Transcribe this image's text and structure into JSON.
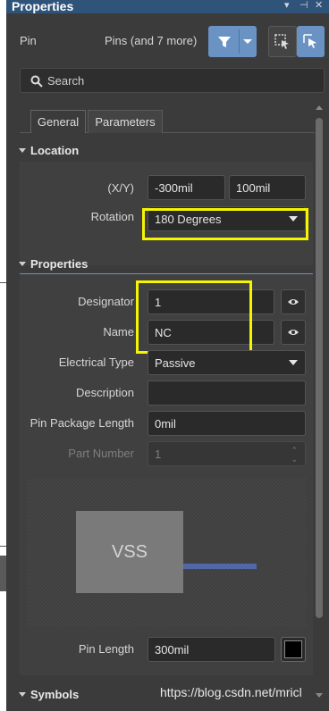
{
  "window": {
    "title": "Properties"
  },
  "header": {
    "object_type": "Pin",
    "selection_summary": "Pins (and 7 more)"
  },
  "search": {
    "placeholder": "Search"
  },
  "tabs": [
    {
      "label": "General"
    },
    {
      "label": "Parameters"
    }
  ],
  "location": {
    "section_label": "Location",
    "xy_label": "(X/Y)",
    "x_value": "-300mil",
    "y_value": "100mil",
    "rotation_label": "Rotation",
    "rotation_value": "180 Degrees"
  },
  "properties": {
    "section_label": "Properties",
    "designator_label": "Designator",
    "designator_value": "1",
    "name_label": "Name",
    "name_value": "NC",
    "electrical_type_label": "Electrical Type",
    "electrical_type_value": "Passive",
    "description_label": "Description",
    "description_value": "",
    "pin_package_length_label": "Pin Package Length",
    "pin_package_length_value": "0mil",
    "part_number_label": "Part Number",
    "part_number_value": "1",
    "preview_body_text": "VSS",
    "pin_length_label": "Pin Length",
    "pin_length_value": "300mil"
  },
  "symbols": {
    "section_label": "Symbols"
  },
  "watermark": "https://blog.csdn.net/mricl",
  "colors": {
    "highlight": "#f5f500",
    "accent": "#6a93c4",
    "title_bar": "#2f5379",
    "pin_line": "#5268a6"
  }
}
